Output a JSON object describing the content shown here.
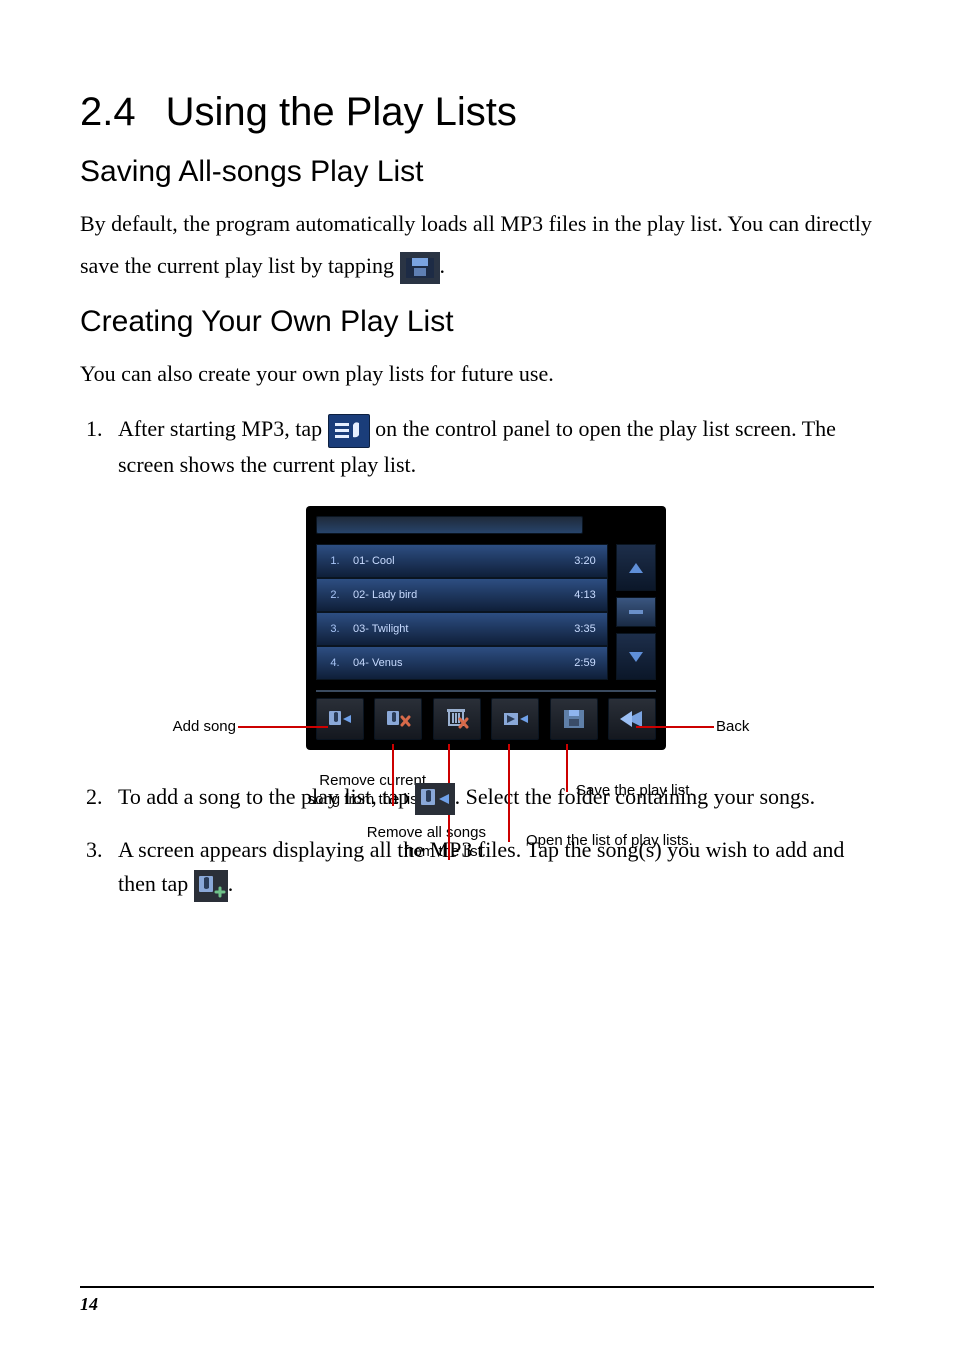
{
  "heading": {
    "number": "2.4",
    "title": "Using the Play Lists"
  },
  "sub1": {
    "title": "Saving All-songs Play List",
    "para_a": "By default, the program automatically loads all MP3 files in the play list. You can directly save the current play list by tapping ",
    "para_b": "."
  },
  "sub2": {
    "title": "Creating Your Own Play List",
    "intro": "You can also create your own play lists for future use.",
    "steps": {
      "s1a": "After starting MP3, tap ",
      "s1b": " on the control panel to open the play list screen. The screen shows the current play list.",
      "s2a": "To add a song to the play list, tap ",
      "s2b": ". Select the folder containing your songs.",
      "s3a": "A screen appears displaying all the MP3 files. Tap the song(s) you wish to add and then tap ",
      "s3b": "."
    }
  },
  "playlist": [
    {
      "idx": "1.",
      "title": "01- Cool",
      "dur": "3:20"
    },
    {
      "idx": "2.",
      "title": "02- Lady bird",
      "dur": "4:13"
    },
    {
      "idx": "3.",
      "title": "03- Twilight",
      "dur": "3:35"
    },
    {
      "idx": "4.",
      "title": "04- Venus",
      "dur": "2:59"
    }
  ],
  "callouts": {
    "add": "Add song",
    "back": "Back",
    "remove_current": "Remove current\nsong from the list.",
    "remove_all": "Remove all songs\nfrom the list.",
    "save": "Save the play list.",
    "open": "Open the list of play lists."
  },
  "page_number": "14"
}
